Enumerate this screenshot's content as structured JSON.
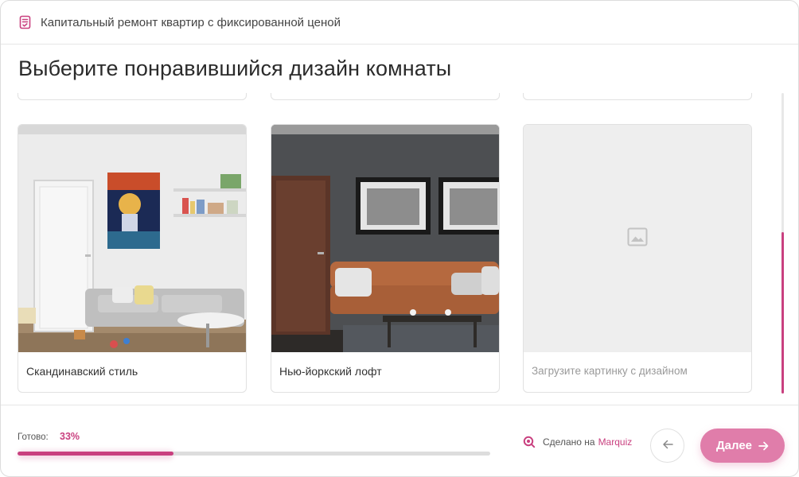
{
  "header": {
    "quiz_title": "Капитальный ремонт квартир с фиксированной ценой",
    "icon": "checklist-icon"
  },
  "question": {
    "title": "Выберите понравившийся дизайн комнаты"
  },
  "options": [
    {
      "label": "Скандинавский стиль",
      "image": "scandinavian-living-room-photo"
    },
    {
      "label": "Нью-йоркский лофт",
      "image": "new-york-loft-living-room-photo"
    },
    {
      "label": "Загрузите картинку с дизайном",
      "image": "image-placeholder-icon"
    }
  ],
  "footer": {
    "progress_label": "Готово:",
    "progress_value": "33%",
    "progress_fraction": 0.33,
    "made_by_prefix": "Сделано на",
    "made_by_brand": "Marquiz",
    "next_label": "Далее"
  },
  "colors": {
    "accent": "#c9407f",
    "button": "#e07daa",
    "track": "#dddddd"
  }
}
